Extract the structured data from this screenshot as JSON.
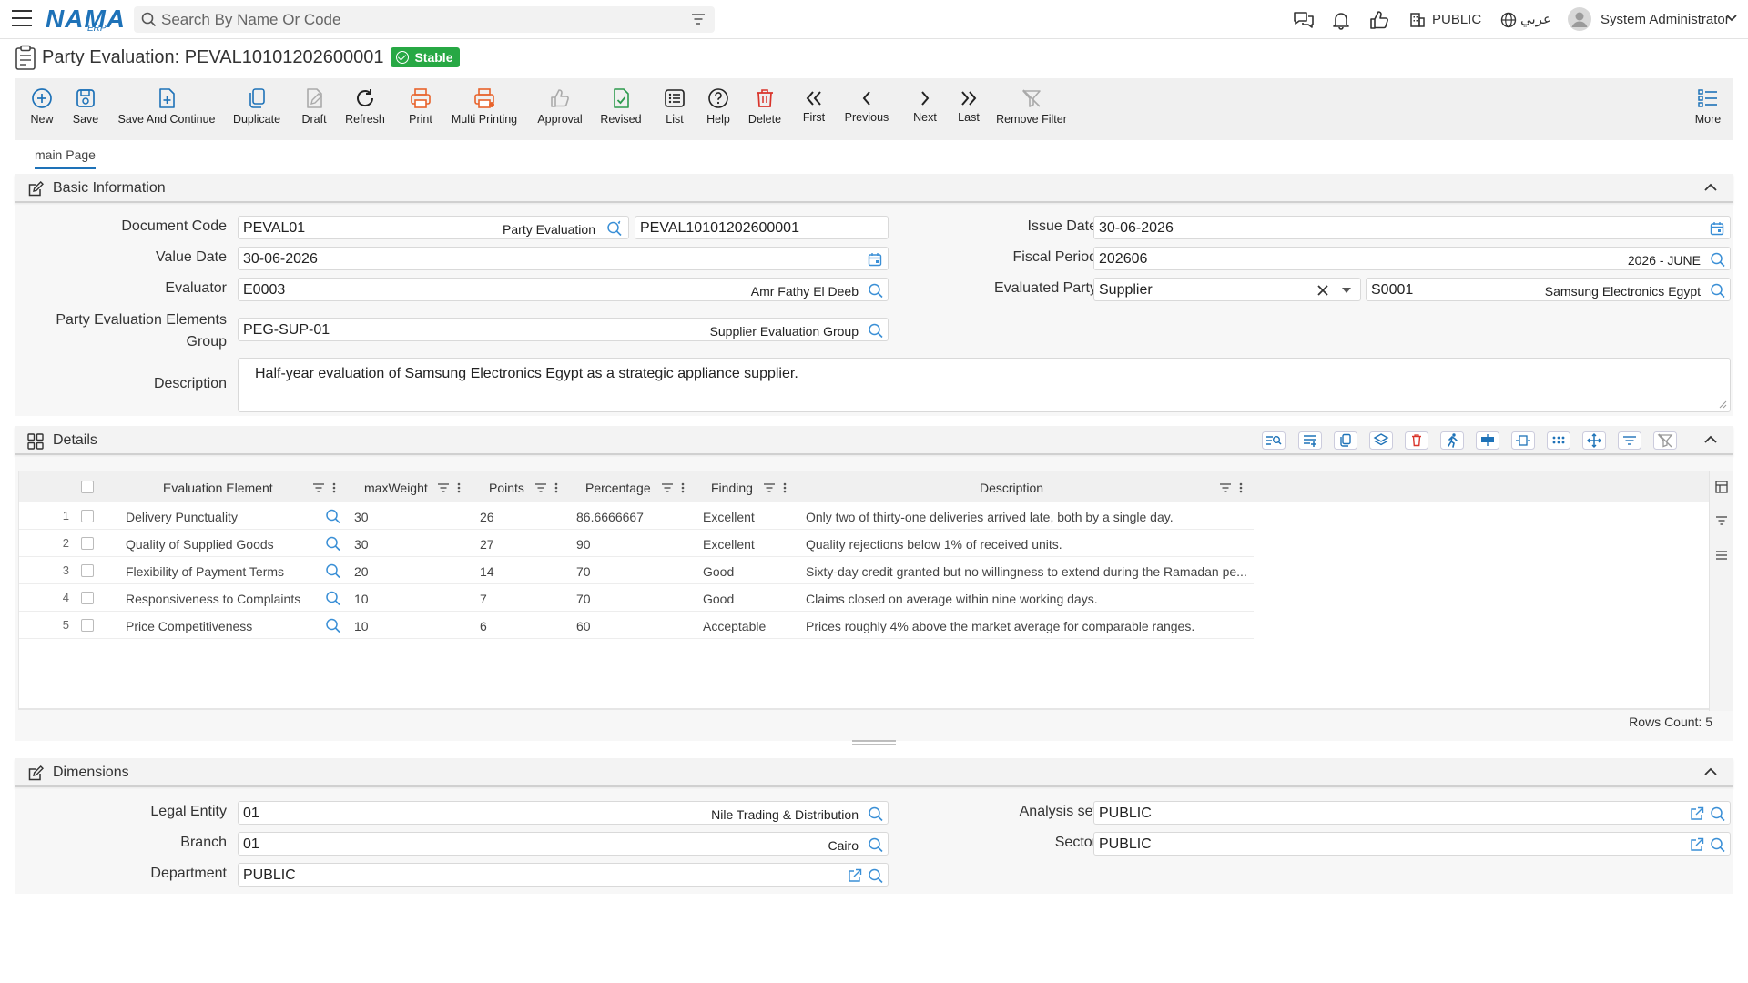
{
  "app": {
    "brand": "NAMA",
    "brand_sub": "ERP",
    "search_placeholder": "Search By Name Or Code",
    "public_label": "PUBLIC",
    "language_label": "عربي",
    "user_name": "System Administrator"
  },
  "page": {
    "title": "Party Evaluation: PEVAL10101202600001",
    "status": "Stable"
  },
  "toolbar": {
    "new": "New",
    "save": "Save",
    "save_continue": "Save And Continue",
    "duplicate": "Duplicate",
    "draft": "Draft",
    "refresh": "Refresh",
    "print": "Print",
    "multi_printing": "Multi Printing",
    "approval": "Approval",
    "revised": "Revised",
    "list": "List",
    "help": "Help",
    "delete": "Delete",
    "first": "First",
    "previous": "Previous",
    "next": "Next",
    "last": "Last",
    "remove_filter": "Remove Filter",
    "more": "More"
  },
  "tabs": {
    "main": "main Page"
  },
  "basic": {
    "title": "Basic Information",
    "document_code_label": "Document Code",
    "document_code": "PEVAL01",
    "document_code_name": "Party Evaluation",
    "document_number": "PEVAL10101202600001",
    "issue_date_label": "Issue Date",
    "issue_date": "30-06-2026",
    "value_date_label": "Value Date",
    "value_date": "30-06-2026",
    "fiscal_period_label": "Fiscal Period",
    "fiscal_period": "202606",
    "fiscal_period_name": "2026 - JUNE",
    "evaluator_label": "Evaluator",
    "evaluator": "E0003",
    "evaluator_name": "Amr Fathy El Deeb",
    "evaluated_party_label": "Evaluated Party",
    "evaluated_party_type": "Supplier",
    "evaluated_party_code": "S0001",
    "evaluated_party_name": "Samsung Electronics Egypt",
    "elements_group_label_1": "Party Evaluation Elements",
    "elements_group_label_2": "Group",
    "elements_group": "PEG-SUP-01",
    "elements_group_name": "Supplier Evaluation Group",
    "description_label": "Description",
    "description": "Half-year evaluation of Samsung Electronics Egypt as a strategic appliance supplier."
  },
  "details": {
    "title": "Details",
    "columns": [
      "Evaluation Element",
      "maxWeight",
      "Points",
      "Percentage",
      "Finding",
      "Description"
    ],
    "rows": [
      {
        "num": "1",
        "element": "Delivery Punctuality",
        "max": "30",
        "points": "26",
        "pct": "86.6666667",
        "finding": "Excellent",
        "desc": "Only two of thirty-one deliveries arrived late, both by a single day."
      },
      {
        "num": "2",
        "element": "Quality of Supplied Goods",
        "max": "30",
        "points": "27",
        "pct": "90",
        "finding": "Excellent",
        "desc": "Quality rejections below 1% of received units."
      },
      {
        "num": "3",
        "element": "Flexibility of Payment Terms",
        "max": "20",
        "points": "14",
        "pct": "70",
        "finding": "Good",
        "desc": "Sixty-day credit granted but no willingness to extend during the Ramadan pe..."
      },
      {
        "num": "4",
        "element": "Responsiveness to Complaints",
        "max": "10",
        "points": "7",
        "pct": "70",
        "finding": "Good",
        "desc": "Claims closed on average within nine working days."
      },
      {
        "num": "5",
        "element": "Price Competitiveness",
        "max": "10",
        "points": "6",
        "pct": "60",
        "finding": "Acceptable",
        "desc": "Prices roughly 4% above the market average for comparable ranges."
      }
    ],
    "rows_count": "Rows Count: 5"
  },
  "dimensions": {
    "title": "Dimensions",
    "legal_entity_label": "Legal Entity",
    "legal_entity": "01",
    "legal_entity_name": "Nile Trading & Distribution",
    "analysis_set_label": "Analysis set",
    "analysis_set": "PUBLIC",
    "branch_label": "Branch",
    "branch": "01",
    "branch_name": "Cairo",
    "sector_label": "Sector",
    "sector": "PUBLIC",
    "department_label": "Department",
    "department": "PUBLIC"
  },
  "colors": {
    "accent": "#1e72b8",
    "stable": "#27a844",
    "delete_red": "#d9342b",
    "print_orange": "#e8632b",
    "revised_green": "#2e9b4e"
  }
}
